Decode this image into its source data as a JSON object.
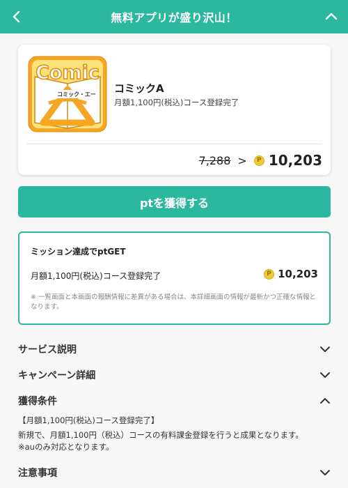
{
  "header": {
    "title": "無料アプリが盛り沢山！"
  },
  "app": {
    "icon_text": "Comic",
    "icon_subtext": "コミック・エー",
    "name": "コミックA",
    "description": "月額1,100円(税込)コース登録完了",
    "old_points": "7,288",
    "arrow": ">",
    "new_points": "10,203"
  },
  "coin_symbol": "P",
  "get_button": {
    "label": "ptを獲得する"
  },
  "mission": {
    "title": "ミッション達成でptGET",
    "item_label": "月額1,100円(税込)コース登録完了",
    "item_points": "10,203",
    "note": "※ 一覧画面と本画面の報酬情報に差異がある場合は、本詳細画面の情報が最新かつ正確な情報となります。"
  },
  "sections": {
    "service": "サービス説明",
    "campaign": "キャンペーン詳細",
    "conditions": "獲得条件",
    "notes": "注意事項"
  },
  "conditions": {
    "title": "【月額1,100円(税込)コース登録完了】",
    "line1": "新規で、月額1,100円（税込）コースの有料課金登録を行うと成果となります。",
    "line2": "※auのみ対応となります。"
  },
  "colors": {
    "brand": "#2cb79f",
    "coin": "#f0c93a",
    "icon_orange": "#f5a623"
  },
  "icons": [
    "back-arrow-icon",
    "chevron-up-icon",
    "chevron-down-icon",
    "point-coin-icon",
    "comic-app-icon"
  ]
}
